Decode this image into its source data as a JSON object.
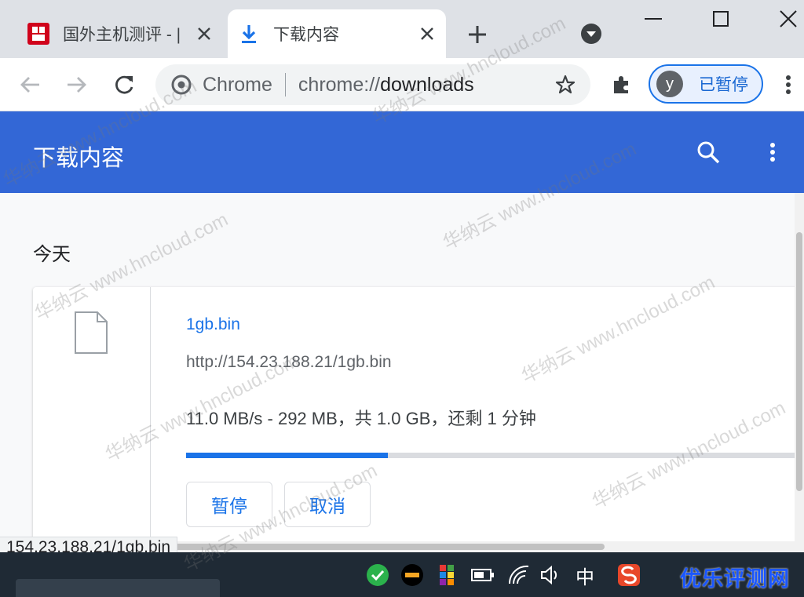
{
  "window": {
    "tabs": [
      {
        "title": "国外主机测评 - |",
        "active": false
      },
      {
        "title": "下载内容",
        "active": true
      }
    ],
    "controls": {
      "minimize": "minimize",
      "maximize": "maximize",
      "close": "close"
    }
  },
  "toolbar": {
    "chip": "Chrome",
    "url_scheme": "chrome://",
    "url_host": "downloads",
    "profile_initial": "y",
    "profile_label": "已暂停"
  },
  "downloads": {
    "page_title": "下载内容",
    "section": "今天",
    "item": {
      "file_name": "1gb.bin",
      "url": "http://154.23.188.21/1gb.bin",
      "status": "11.0 MB/s - 292 MB，共 1.0 GB，还剩 1 分钟",
      "progress_fraction": 0.33,
      "pause_label": "暂停",
      "cancel_label": "取消"
    }
  },
  "status_bar": {
    "text": "154.23.188.21/1gb.bin"
  },
  "taskbar": {
    "ime": "中",
    "brand": "优乐评测网"
  },
  "watermark": "华纳云 www.hncloud.com",
  "colors": {
    "accent": "#1a73e8",
    "header": "#3367d6"
  }
}
